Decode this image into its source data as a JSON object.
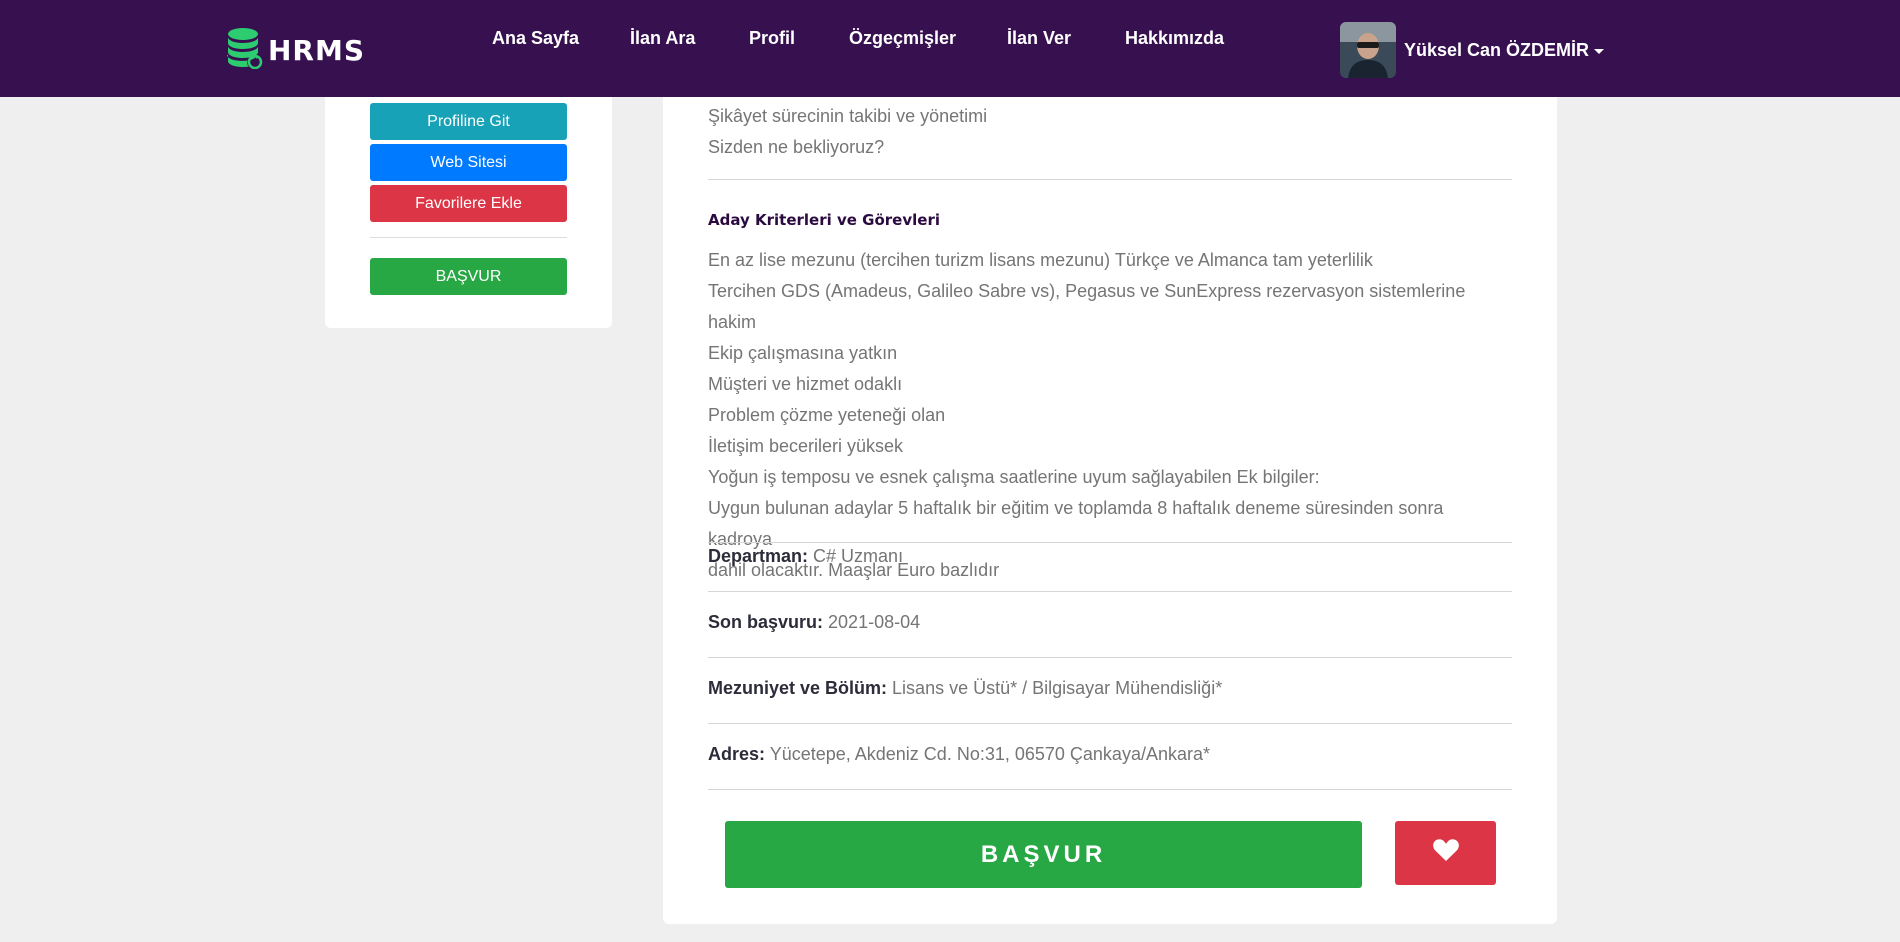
{
  "navbar": {
    "logo_text": "HRMS",
    "items": [
      {
        "label": "Ana Sayfa"
      },
      {
        "label": "İlan Ara"
      },
      {
        "label": "Profil"
      },
      {
        "label": "Özgeçmişler"
      },
      {
        "label": "İlan Ver"
      },
      {
        "label": "Hakkımızda"
      }
    ],
    "user_name": "Yüksel Can ÖZDEMİR"
  },
  "sidebar": {
    "profile_button": "Profiline Git",
    "website_button": "Web Sitesi",
    "favorite_button": "Favorilere Ekle",
    "apply_button": "BAŞVUR"
  },
  "main": {
    "top_lines": [
      "Şikâyet sürecinin takibi ve yönetimi",
      "Sizden ne bekliyoruz?"
    ],
    "criteria_title": "Aday Kriterleri ve Görevleri",
    "criteria_lines": [
      "En az lise mezunu (tercihen turizm lisans mezunu) Türkçe ve Almanca tam yeterlilik",
      "Tercihen GDS (Amadeus, Galileo Sabre vs), Pegasus ve SunExpress rezervasyon sistemlerine hakim",
      "Ekip çalışmasına yatkın",
      "Müşteri ve hizmet odaklı",
      "Problem çözme yeteneği olan",
      "İletişim becerileri yüksek",
      "Yoğun iş temposu ve esnek çalışma saatlerine uyum sağlayabilen Ek bilgiler:",
      "Uygun bulunan adaylar 5 haftalık bir eğitim ve toplamda 8 haftalık deneme süresinden sonra kadroya",
      "dahil olacaktır. Maaşlar Euro bazlıdır"
    ],
    "department": {
      "label": "Departman:",
      "value": "C# Uzmanı"
    },
    "deadline": {
      "label": "Son başvuru:",
      "value": "2021-08-04"
    },
    "education": {
      "label": "Mezuniyet ve Bölüm:",
      "value": "Lisans ve Üstü* / Bilgisayar Mühendisliği*"
    },
    "address": {
      "label": "Adres:",
      "value": "Yücetepe, Akdeniz Cd. No:31, 06570 Çankaya/Ankara*"
    },
    "apply_button": "BAŞVUR"
  },
  "colors": {
    "navbar": "#37104f",
    "teal": "#17a2b8",
    "blue": "#007bff",
    "red": "#dc3545",
    "green": "#28a745"
  }
}
